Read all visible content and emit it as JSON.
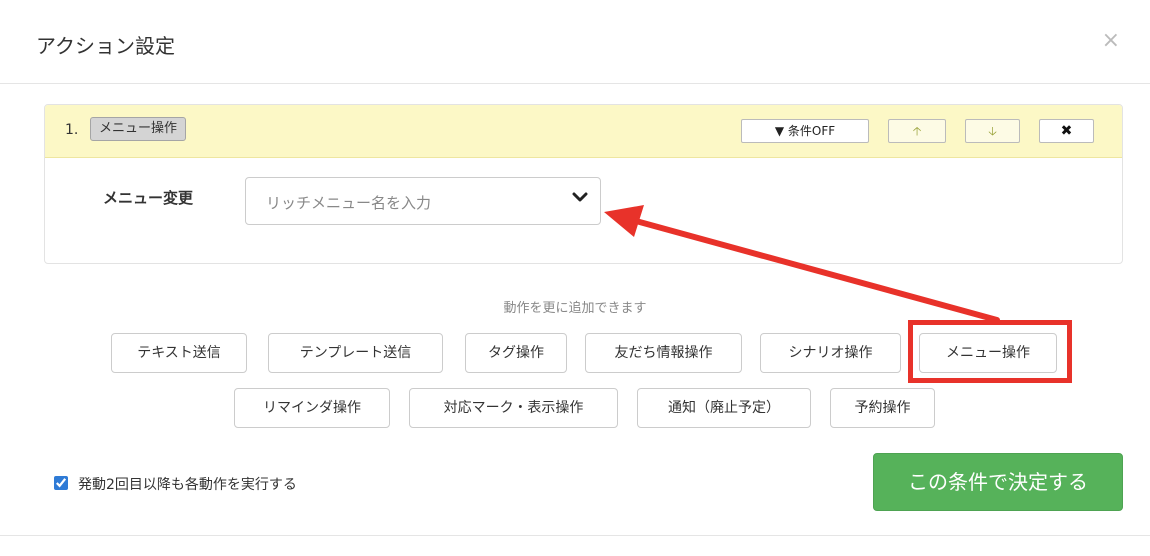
{
  "modal": {
    "title": "アクション設定",
    "close_glyph": "×"
  },
  "action": {
    "index_label": "1.",
    "type_tag": "メニュー操作",
    "condition_button": "▼ 条件OFF",
    "move_up_glyph": "🡡",
    "move_down_glyph": "🡣",
    "remove_glyph": "✖",
    "field_label": "メニュー変更",
    "select_placeholder": "リッチメニュー名を入力"
  },
  "add_hint": "動作を更に追加できます",
  "operations": [
    {
      "label": "テキスト送信"
    },
    {
      "label": "テンプレート送信"
    },
    {
      "label": "タグ操作"
    },
    {
      "label": "友だち情報操作"
    },
    {
      "label": "シナリオ操作"
    },
    {
      "label": "メニュー操作"
    },
    {
      "label": "リマインダ操作"
    },
    {
      "label": "対応マーク・表示操作"
    },
    {
      "label": "通知（廃止予定）"
    },
    {
      "label": "予約操作"
    }
  ],
  "highlighted_operation": "メニュー操作",
  "repeat_option": {
    "label": "発動2回目以降も各動作を実行する",
    "checked": true
  },
  "confirm_button": "この条件で決定する",
  "colors": {
    "panel_heading_bg": "#fcf8c6",
    "confirm_green": "#56b25a",
    "annotation_red": "#e8322a"
  },
  "icons": {
    "close": "close-icon",
    "condition": "filter-icon",
    "up": "arrow-up-icon",
    "down": "arrow-down-icon",
    "remove": "remove-icon",
    "select": "chevron-down-icon",
    "checkbox": "checkbox-icon"
  }
}
